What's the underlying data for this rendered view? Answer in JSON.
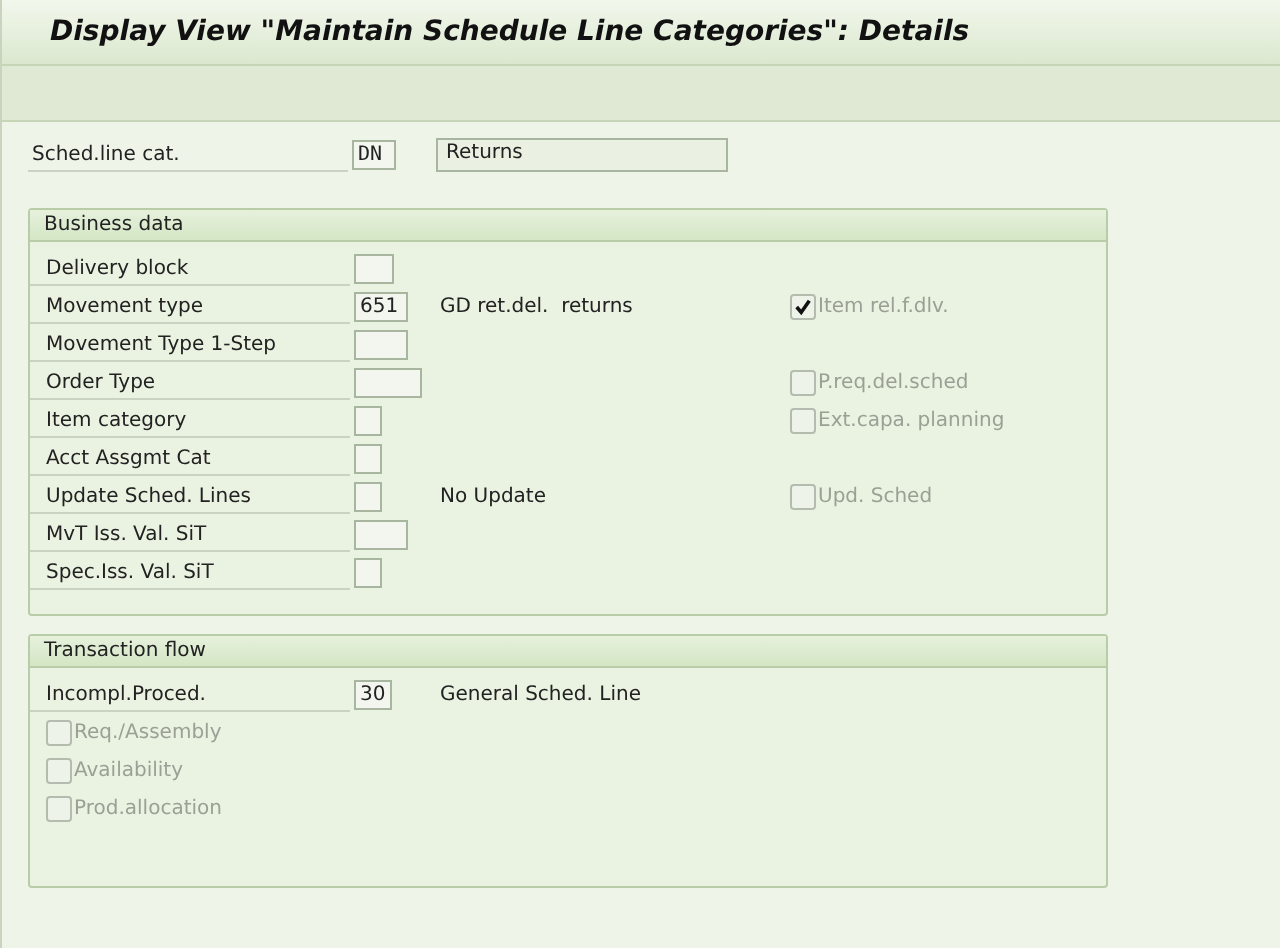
{
  "window": {
    "title": "Display View \"Maintain Schedule Line Categories\": Details"
  },
  "header": {
    "label": "Sched.line cat.",
    "value": "DN",
    "description": "Returns"
  },
  "business_data": {
    "title": "Business data",
    "rows": [
      {
        "label": "Delivery block",
        "kind": "small"
      },
      {
        "label": "Movement type",
        "value": "651",
        "kind": "medium",
        "description": "GD ret.del.  returns",
        "checkbox": {
          "label": "Item rel.f.dlv.",
          "checked": true,
          "disabled": true
        }
      },
      {
        "label": "Movement Type 1-Step",
        "kind": "medium"
      },
      {
        "label": "Order Type",
        "kind": "wide",
        "checkbox": {
          "label": "P.req.del.sched",
          "checked": false,
          "disabled": true
        }
      },
      {
        "label": "Item category",
        "kind": "tiny",
        "checkbox": {
          "label": "Ext.capa. planning",
          "checked": false,
          "disabled": true
        }
      },
      {
        "label": "Acct Assgmt Cat",
        "kind": "tiny"
      },
      {
        "label": "Update Sched. Lines",
        "kind": "tiny",
        "description": "No Update",
        "checkbox": {
          "label": "Upd. Sched",
          "checked": false,
          "disabled": true
        }
      },
      {
        "label": "MvT Iss. Val. SiT",
        "kind": "medium"
      },
      {
        "label": "Spec.Iss. Val. SiT",
        "kind": "tiny"
      }
    ]
  },
  "transaction_flow": {
    "title": "Transaction flow",
    "rows": [
      {
        "label": "Incompl.Proced.",
        "value": "30",
        "kind": "tiny",
        "description": "General Sched. Line"
      }
    ],
    "checkboxes": [
      {
        "label": "Req./Assembly",
        "checked": false,
        "disabled": true
      },
      {
        "label": "Availability",
        "checked": false,
        "disabled": true
      },
      {
        "label": "Prod.allocation",
        "checked": false,
        "disabled": true
      }
    ]
  }
}
